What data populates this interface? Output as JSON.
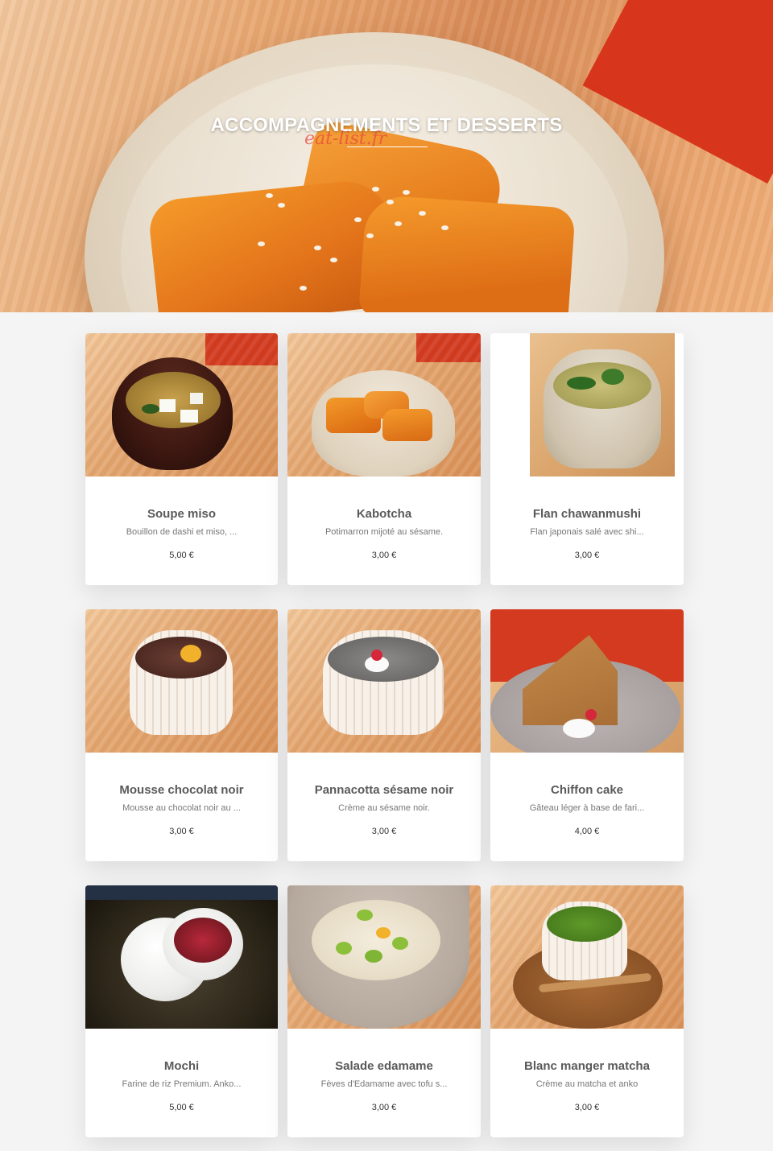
{
  "hero": {
    "title": "ACCOMPAGNEMENTS ET DESSERTS",
    "watermark": "eat-list.fr"
  },
  "items": [
    {
      "name": "Soupe miso",
      "description": "Bouillon de dashi et miso, ...",
      "price": "5,00 €"
    },
    {
      "name": "Kabotcha",
      "description": "Potimarron mijoté au sésame.",
      "price": "3,00 €"
    },
    {
      "name": "Flan chawanmushi",
      "description": "Flan japonais salé avec shi...",
      "price": "3,00 €"
    },
    {
      "name": "Mousse chocolat noir",
      "description": "Mousse au chocolat noir au ...",
      "price": "3,00 €"
    },
    {
      "name": "Pannacotta sésame noir",
      "description": "Crème au sésame noir.",
      "price": "3,00 €"
    },
    {
      "name": "Chiffon cake",
      "description": "Gâteau léger à base de fari...",
      "price": "4,00 €"
    },
    {
      "name": "Mochi",
      "description": "Farine de riz Premium. Anko...",
      "price": "5,00 €"
    },
    {
      "name": "Salade edamame",
      "description": "Fèves d'Edamame avec tofu s...",
      "price": "3,00 €"
    },
    {
      "name": "Blanc manger matcha",
      "description": "Crème au matcha et anko",
      "price": "3,00 €"
    }
  ]
}
